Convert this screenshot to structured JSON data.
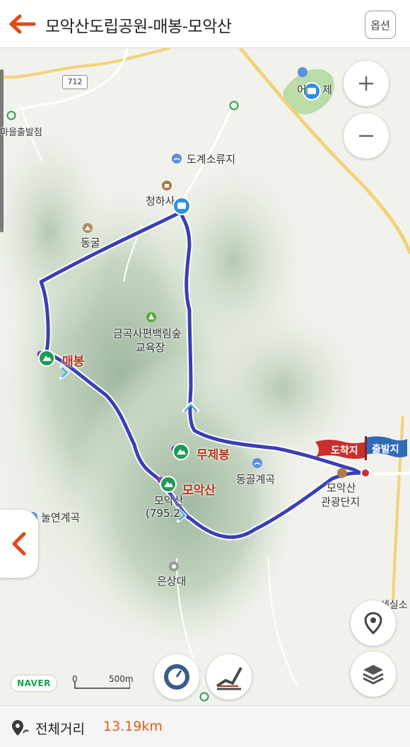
{
  "header": {
    "title": "모악산도립공원-매봉-모악산",
    "options_label": "옵션"
  },
  "map": {
    "road_number": "712",
    "labels": {
      "village_start": "마을출발점",
      "reservoir": "도계소류지",
      "temple": "청하사",
      "cave": "동굴",
      "forest_1": "금곡사편백림숲",
      "forest_2": "교육장",
      "peak_maebong": "매봉",
      "peak_mujebong": "무제봉",
      "valley_donggol": "동골계곡",
      "peak_moaksan": "모악산",
      "moaksan_name": "모악산",
      "moaksan_height": "(795.2",
      "valley_nulyeon": "눌연계곡",
      "eunsangdae": "은상대",
      "tourist_1": "모악산",
      "tourist_2": "관광단지",
      "edge_right": "세실소",
      "edge_top": "어",
      "edge_top2": "제"
    },
    "flags": {
      "arrive": "도착지",
      "depart": "출발지"
    },
    "naver_logo": "NAVER",
    "scale": {
      "zero": "0",
      "value": "500m"
    },
    "colors": {
      "route": "#3b3fb5",
      "accent": "#e25a18",
      "arrive_flag": "#c9302c",
      "depart_flag": "#2f6bb8"
    }
  },
  "footer": {
    "distance_label": "전체거리",
    "distance_value": "13.19km"
  }
}
